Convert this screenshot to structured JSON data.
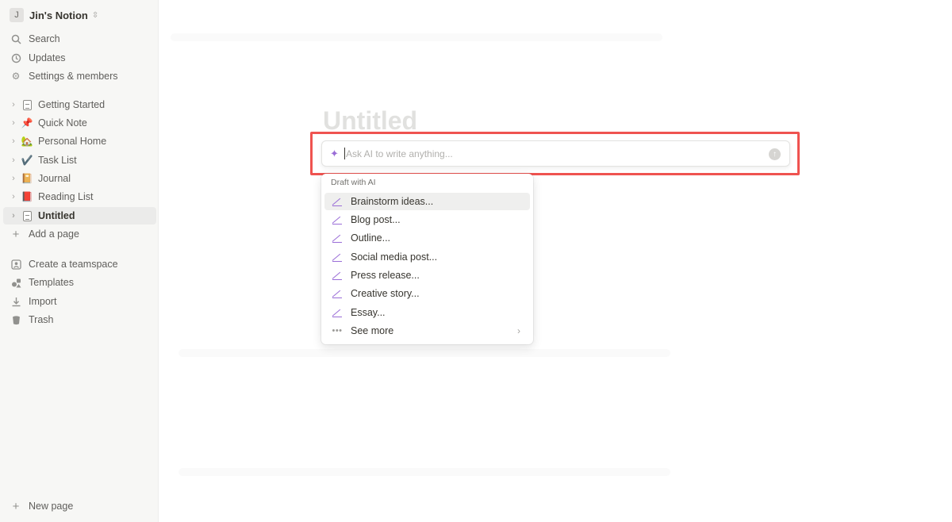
{
  "workspace": {
    "avatar": "J",
    "name": "Jin's Notion",
    "switch_icon": "chevron-updown-icon"
  },
  "sidebar": {
    "top_items": [
      {
        "label": "Search",
        "icon": "search-icon"
      },
      {
        "label": "Updates",
        "icon": "clock-icon"
      },
      {
        "label": "Settings & members",
        "icon": "gear-icon"
      }
    ],
    "pages": [
      {
        "label": "Getting Started",
        "emoji": "doc"
      },
      {
        "label": "Quick Note",
        "emoji": "📌"
      },
      {
        "label": "Personal Home",
        "emoji": "🏡"
      },
      {
        "label": "Task List",
        "emoji": "✔️"
      },
      {
        "label": "Journal",
        "emoji": "📔"
      },
      {
        "label": "Reading List",
        "emoji": "📕"
      },
      {
        "label": "Untitled",
        "emoji": "doc"
      }
    ],
    "add_page": "Add a page",
    "bottom_items": [
      {
        "label": "Create a teamspace",
        "icon": "teamspace-icon"
      },
      {
        "label": "Templates",
        "icon": "shapes-icon"
      },
      {
        "label": "Import",
        "icon": "download-icon"
      },
      {
        "label": "Trash",
        "icon": "trash-icon"
      }
    ],
    "new_page": "New page"
  },
  "page": {
    "title_placeholder": "Untitled"
  },
  "ai_prompt": {
    "placeholder": "Ask AI to write anything...",
    "value": ""
  },
  "ai_menu": {
    "heading": "Draft with AI",
    "items": [
      "Brainstorm ideas...",
      "Blog post...",
      "Outline...",
      "Social media post...",
      "Press release...",
      "Creative story...",
      "Essay..."
    ],
    "see_more": "See more"
  },
  "colors": {
    "highlight_border": "#ef5350",
    "ai_accent": "#9a6dd7",
    "sidebar_bg": "#f7f7f5"
  }
}
